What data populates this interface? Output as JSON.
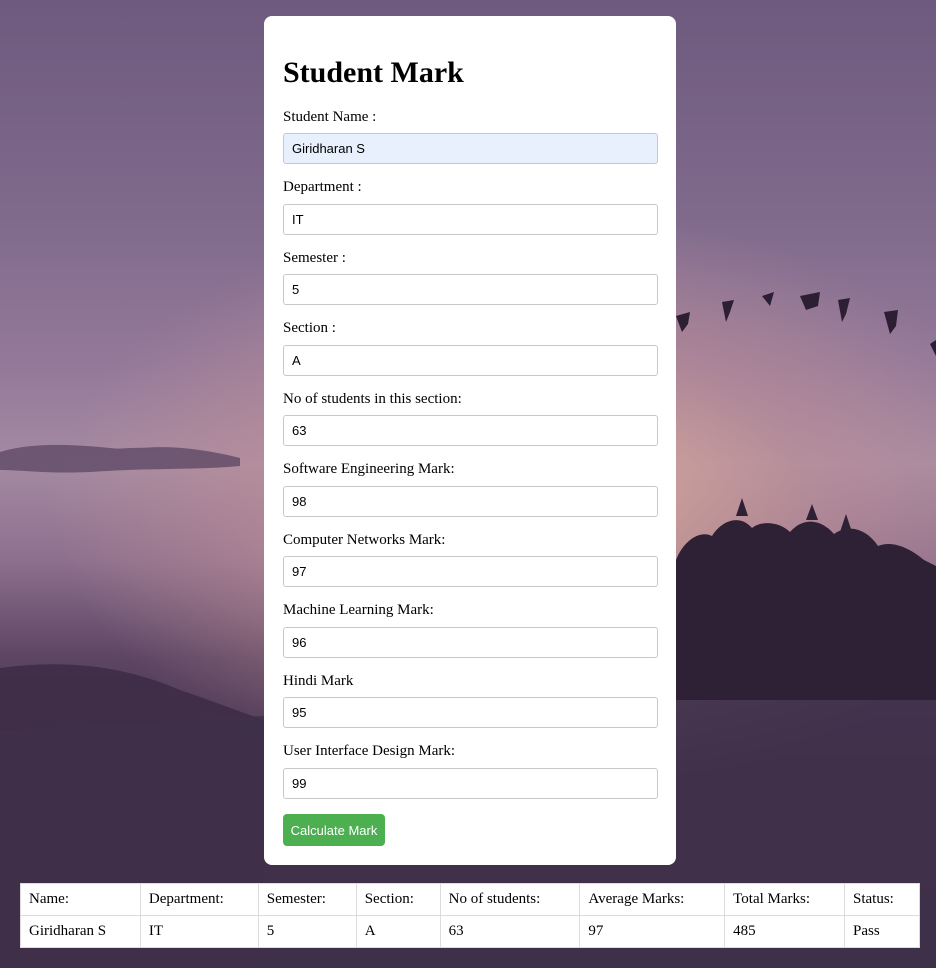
{
  "form": {
    "title": "Student Mark",
    "fields": [
      {
        "label": "Student Name :",
        "value": "Giridharan S"
      },
      {
        "label": "Department :",
        "value": "IT"
      },
      {
        "label": "Semester :",
        "value": "5"
      },
      {
        "label": "Section :",
        "value": "A"
      },
      {
        "label": "No of students in this section:",
        "value": "63"
      },
      {
        "label": "Software Engineering Mark:",
        "value": "98"
      },
      {
        "label": "Computer Networks Mark:",
        "value": "97"
      },
      {
        "label": "Machine Learning Mark:",
        "value": "96"
      },
      {
        "label": "Hindi Mark",
        "value": "95"
      },
      {
        "label": "User Interface Design Mark:",
        "value": "99"
      }
    ],
    "submit_label": "Calculate Mark"
  },
  "result": {
    "headers": [
      "Name:",
      "Department:",
      "Semester:",
      "Section:",
      "No of students:",
      "Average Marks:",
      "Total Marks:",
      "Status:"
    ],
    "row": [
      "Giridharan S",
      "IT",
      "5",
      "A",
      "63",
      "97",
      "485",
      "Pass"
    ]
  },
  "colors": {
    "button": "#4caf50",
    "autofill": "#e8f0fe"
  }
}
